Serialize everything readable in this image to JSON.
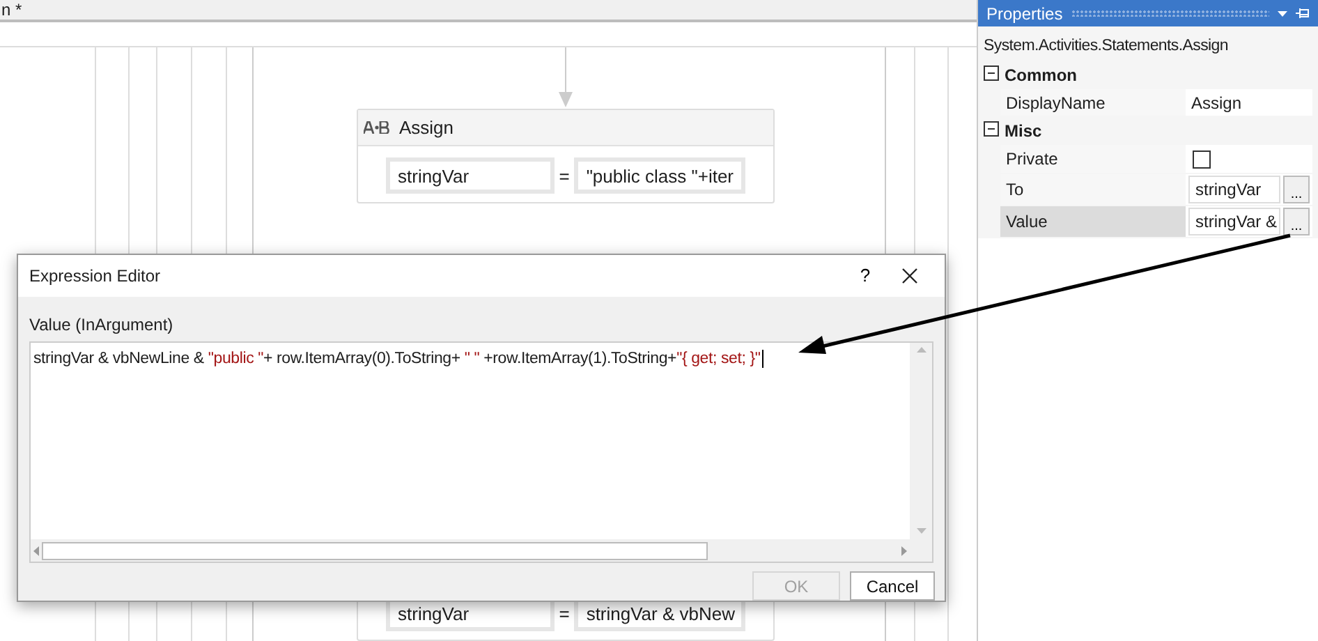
{
  "document_tab": {
    "title": "n *"
  },
  "designer": {
    "activities": [
      {
        "title": "Assign",
        "to": "stringVar",
        "operator": "=",
        "value": "\"public class \"+iter"
      },
      {
        "to": "stringVar",
        "operator": "=",
        "value": "stringVar & vbNew"
      }
    ]
  },
  "properties": {
    "title": "Properties",
    "type_name": "System.Activities.Statements.Assign",
    "rows": [
      {
        "kind": "category",
        "label": "Common",
        "expanded": true
      },
      {
        "kind": "text",
        "label": "DisplayName",
        "value": "Assign",
        "selected": false
      },
      {
        "kind": "category",
        "label": "Misc",
        "expanded": true
      },
      {
        "kind": "checkbox",
        "label": "Private",
        "checked": false,
        "selected": false
      },
      {
        "kind": "expression",
        "label": "To",
        "value": "stringVar",
        "button": "...",
        "selected": false
      },
      {
        "kind": "expression",
        "label": "Value",
        "value": "stringVar &",
        "button": "...",
        "selected": true
      }
    ]
  },
  "dialog": {
    "title": "Expression Editor",
    "help": "?",
    "label": "Value (InArgument)",
    "expression": [
      {
        "kind": "code",
        "text": "stringVar & vbNewLine & "
      },
      {
        "kind": "string",
        "text": "\"public \""
      },
      {
        "kind": "code",
        "text": "+ row.ItemArray(0).ToString+ "
      },
      {
        "kind": "string",
        "text": "\" \""
      },
      {
        "kind": "code",
        "text": " +row.ItemArray(1).ToString+"
      },
      {
        "kind": "string",
        "text": "\"{ get; set; }\""
      }
    ],
    "buttons": [
      {
        "label": "OK",
        "disabled": true
      },
      {
        "label": "Cancel",
        "disabled": false
      }
    ]
  }
}
